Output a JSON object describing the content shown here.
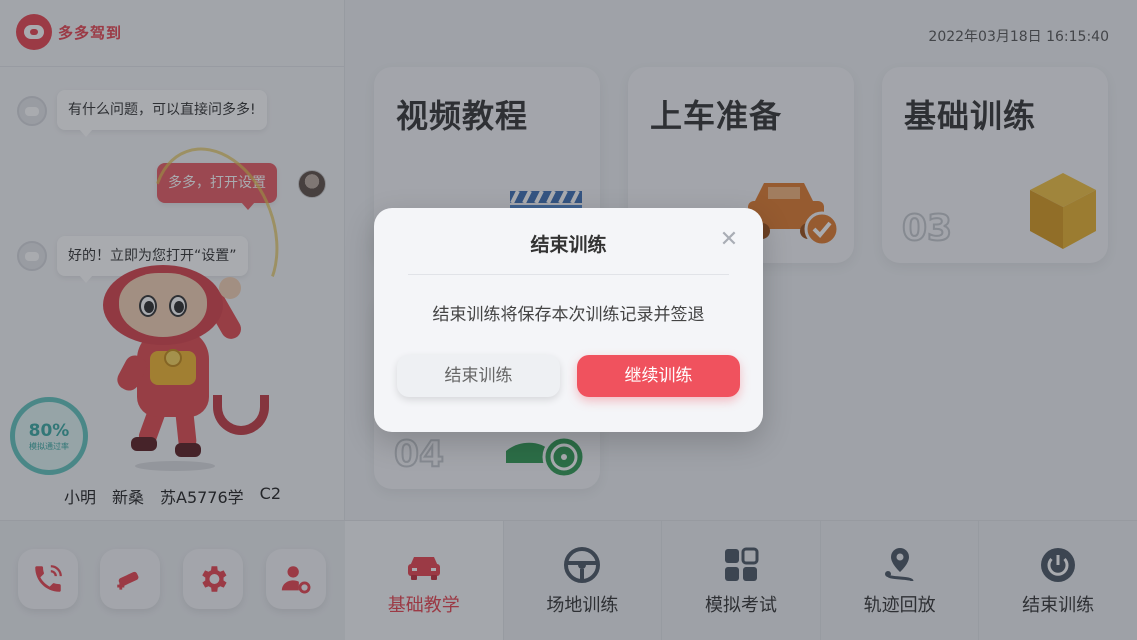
{
  "app": {
    "brand_name": "多多驾到",
    "datetime": "2022年03月18日  16:15:40"
  },
  "chat": {
    "messages": [
      {
        "sender": "assistant",
        "text": "有什么问题，可以直接问多多!"
      },
      {
        "sender": "user",
        "text": "多多，打开设置"
      },
      {
        "sender": "assistant",
        "text": "好的！立即为您打开“设置”"
      }
    ]
  },
  "pass_rate": {
    "value": "80%",
    "caption": "模拟通过率"
  },
  "student": {
    "name": "小明",
    "car_model": "新桑",
    "plate": "苏A5776学",
    "license_class": "C2"
  },
  "left_tools": [
    {
      "icon": "phone-icon"
    },
    {
      "icon": "car-repair-icon"
    },
    {
      "icon": "gear-icon"
    },
    {
      "icon": "user-settings-icon"
    }
  ],
  "cards": [
    {
      "title": "视频教程",
      "number": "",
      "icon": "video-clapper-icon"
    },
    {
      "title": "上车准备",
      "number": "",
      "icon": "car-check-icon"
    },
    {
      "title": "基础训练",
      "number": "03",
      "icon": "box-icon"
    },
    {
      "title": "",
      "number": "04",
      "icon": "steering-wheel-icon"
    }
  ],
  "bottom_nav": [
    {
      "label": "基础教学",
      "icon": "car-icon",
      "active": true
    },
    {
      "label": "场地训练",
      "icon": "steering-wheel-icon",
      "active": false
    },
    {
      "label": "模拟考试",
      "icon": "grid-icon",
      "active": false
    },
    {
      "label": "轨迹回放",
      "icon": "route-pin-icon",
      "active": false
    },
    {
      "label": "结束训练",
      "icon": "power-icon",
      "active": false
    }
  ],
  "dialog": {
    "title": "结束训练",
    "message": "结束训练将保存本次训练记录并签退",
    "end_button": "结束训练",
    "continue_button": "继续训练",
    "close_icon": "close-icon"
  },
  "colors": {
    "brand_red": "#e8434f",
    "continue_button": "#f0525e",
    "pass_rate_teal": "#3aa9a2",
    "icon_grey": "#4a5563",
    "card_orange": "#e07a2c",
    "card_yellow": "#e0a82a",
    "card_green": "#2f9a52"
  }
}
